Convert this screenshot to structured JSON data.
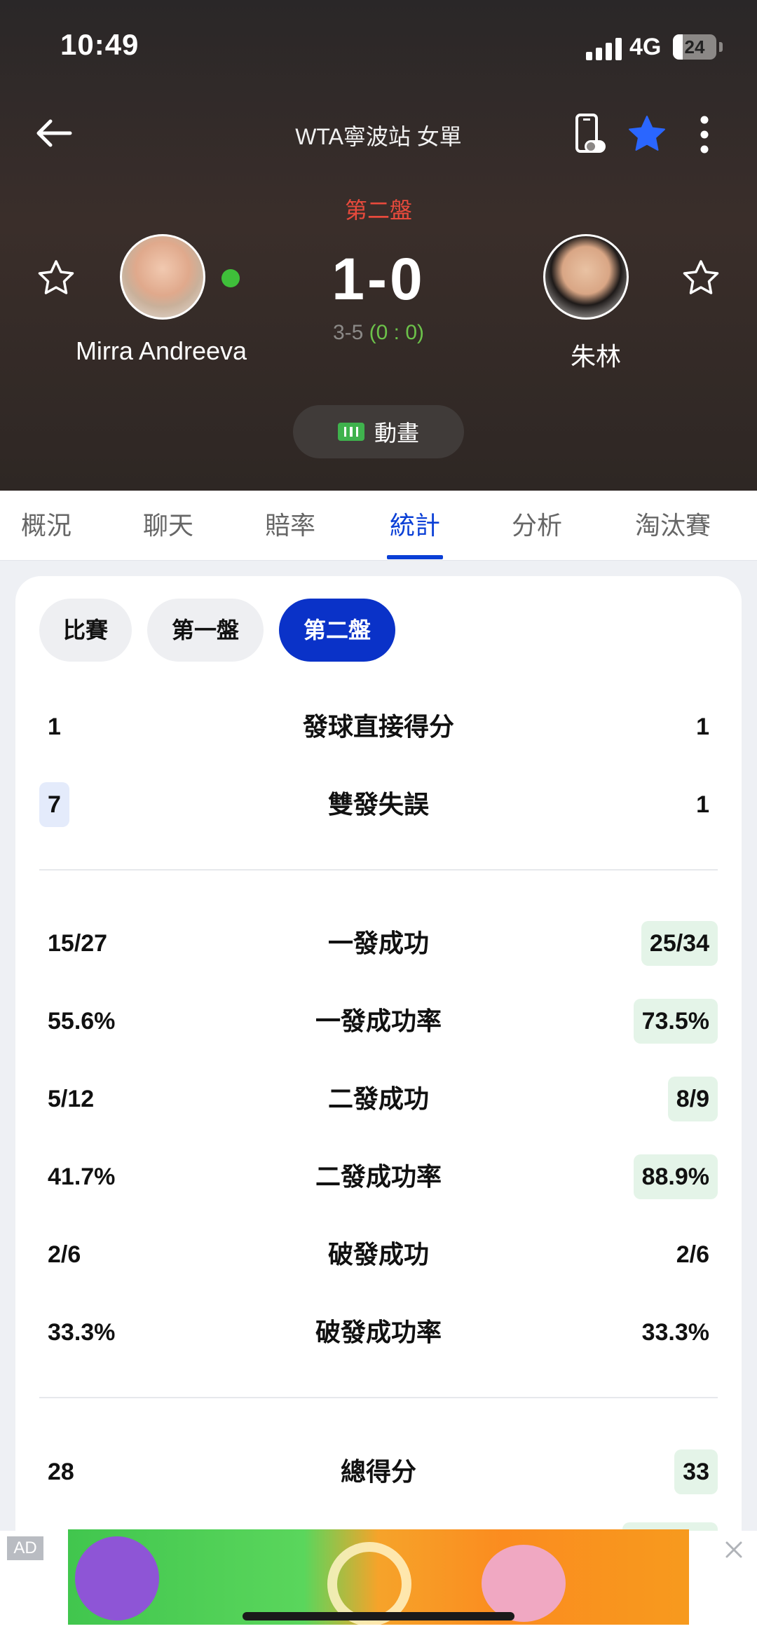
{
  "status_bar": {
    "time": "10:49",
    "network": "4G",
    "battery": "24"
  },
  "nav": {
    "title": "WTA寧波站 女單"
  },
  "match": {
    "set_label": "第二盤",
    "score": "1-0",
    "game_score": "3-5",
    "point_score": "(0 : 0)",
    "player_left": "Mirra Andreeva",
    "player_right": "朱林",
    "animation_label": "動畫"
  },
  "tabs": [
    "概況",
    "聊天",
    "賠率",
    "統計",
    "分析",
    "淘汰賽"
  ],
  "active_tab": "統計",
  "set_filters": [
    "比賽",
    "第一盤",
    "第二盤"
  ],
  "active_filter": "第二盤",
  "stats": [
    {
      "label": "發球直接得分",
      "left": "1",
      "right": "1",
      "highlight": "none"
    },
    {
      "label": "雙發失誤",
      "left": "7",
      "right": "1",
      "highlight": "left"
    },
    {
      "label": "一發成功",
      "left": "15/27",
      "right": "25/34",
      "highlight": "right"
    },
    {
      "label": "一發成功率",
      "left": "55.6%",
      "right": "73.5%",
      "highlight": "right"
    },
    {
      "label": "二發成功",
      "left": "5/12",
      "right": "8/9",
      "highlight": "right"
    },
    {
      "label": "二發成功率",
      "left": "41.7%",
      "right": "88.9%",
      "highlight": "right"
    },
    {
      "label": "破發成功",
      "left": "2/6",
      "right": "2/6",
      "highlight": "none"
    },
    {
      "label": "破發成功率",
      "left": "33.3%",
      "right": "33.3%",
      "highlight": "none"
    },
    {
      "label": "總得分",
      "left": "28",
      "right": "33",
      "highlight": "right"
    }
  ],
  "ad": {
    "tag": "AD"
  },
  "colors": {
    "accent": "#0a3fd6",
    "set_label": "#e84a3c",
    "live": "#6cc24a",
    "left_highlight": "#e4ebfb",
    "right_highlight": "#e4f4e8"
  }
}
